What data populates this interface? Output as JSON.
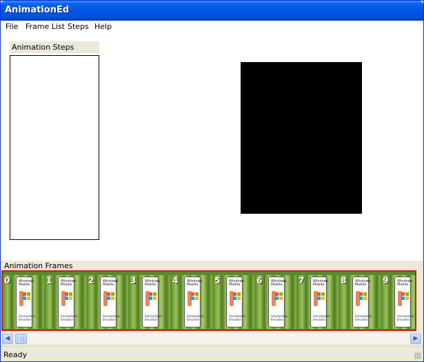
{
  "window": {
    "title": "AnimationEd"
  },
  "menu": {
    "items": [
      "File",
      "Frame List",
      "Steps",
      "Help"
    ]
  },
  "steps_panel": {
    "label": "Animation Steps"
  },
  "frames_panel": {
    "label": "Animation Frames",
    "frames": [
      {
        "number": "0",
        "text_top": "Windows Mobile",
        "text_bottom": "Smartphone Emulator"
      },
      {
        "number": "1",
        "text_top": "Windows Mobile",
        "text_bottom": "Smartphone Emulator"
      },
      {
        "number": "2",
        "text_top": "Windows Mobile",
        "text_bottom": "Smartphone Emulator"
      },
      {
        "number": "3",
        "text_top": "Windows Mobile",
        "text_bottom": "Smartphone Emulator"
      },
      {
        "number": "4",
        "text_top": "Windows Mobile",
        "text_bottom": "Smartphone Emulator"
      },
      {
        "number": "5",
        "text_top": "Windows Mobile",
        "text_bottom": "Smartphone Emulator"
      },
      {
        "number": "6",
        "text_top": "Windows Mobile",
        "text_bottom": "Smartphone Emulator"
      },
      {
        "number": "7",
        "text_top": "Windows Mobile",
        "text_bottom": "Smartphone Emulator"
      },
      {
        "number": "8",
        "text_top": "Windows Mobile",
        "text_bottom": "Smartphone Emulator"
      },
      {
        "number": "9",
        "text_top": "Windows Mobile",
        "text_bottom": "Smartphone Emulator"
      }
    ]
  },
  "scrollbar": {
    "left_icon": "arrow-left-icon",
    "right_icon": "arrow-right-icon"
  },
  "status": {
    "text": "Ready"
  },
  "colors": {
    "frames_border": "#b22c14",
    "preview_bg": "#000000",
    "titlebar": "#0058e6"
  }
}
